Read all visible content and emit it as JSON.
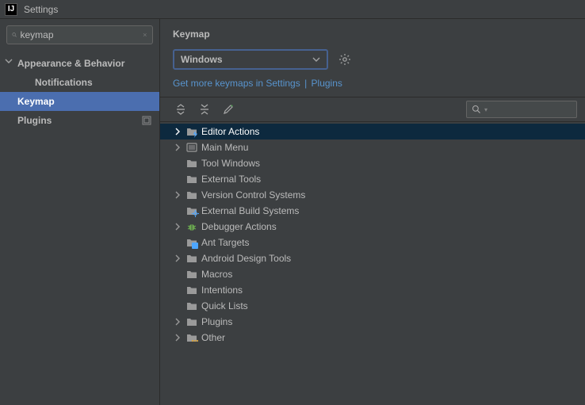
{
  "window": {
    "title": "Settings",
    "app_icon_text": "IJ"
  },
  "sidebar": {
    "search_value": "keymap",
    "items": [
      {
        "label": "Appearance & Behavior",
        "level": 1,
        "expandable": true,
        "expanded": true,
        "selected": false,
        "meta_icon": false
      },
      {
        "label": "Notifications",
        "level": 2,
        "expandable": false,
        "expanded": false,
        "selected": false,
        "meta_icon": false
      },
      {
        "label": "Keymap",
        "level": 1,
        "expandable": false,
        "expanded": false,
        "selected": true,
        "meta_icon": false
      },
      {
        "label": "Plugins",
        "level": 1,
        "expandable": false,
        "expanded": false,
        "selected": false,
        "meta_icon": true
      }
    ]
  },
  "content": {
    "title": "Keymap",
    "scheme": "Windows",
    "link_prefix": "Get more keymaps in ",
    "link_settings": "Settings",
    "link_sep": " | ",
    "link_plugins": "Plugins",
    "tree_search_placeholder": "",
    "tree": [
      {
        "label": "Editor Actions",
        "expandable": true,
        "selected": true,
        "icon": "folder-lightning"
      },
      {
        "label": "Main Menu",
        "expandable": true,
        "selected": false,
        "icon": "menu"
      },
      {
        "label": "Tool Windows",
        "expandable": false,
        "selected": false,
        "icon": "folder"
      },
      {
        "label": "External Tools",
        "expandable": false,
        "selected": false,
        "icon": "folder"
      },
      {
        "label": "Version Control Systems",
        "expandable": true,
        "selected": false,
        "icon": "folder"
      },
      {
        "label": "External Build Systems",
        "expandable": false,
        "selected": false,
        "icon": "folder-gear"
      },
      {
        "label": "Debugger Actions",
        "expandable": true,
        "selected": false,
        "icon": "bug"
      },
      {
        "label": "Ant Targets",
        "expandable": false,
        "selected": false,
        "icon": "folder-blue"
      },
      {
        "label": "Android Design Tools",
        "expandable": true,
        "selected": false,
        "icon": "folder"
      },
      {
        "label": "Macros",
        "expandable": false,
        "selected": false,
        "icon": "folder"
      },
      {
        "label": "Intentions",
        "expandable": false,
        "selected": false,
        "icon": "folder"
      },
      {
        "label": "Quick Lists",
        "expandable": false,
        "selected": false,
        "icon": "folder"
      },
      {
        "label": "Plugins",
        "expandable": true,
        "selected": false,
        "icon": "folder"
      },
      {
        "label": "Other",
        "expandable": true,
        "selected": false,
        "icon": "folder-dots"
      }
    ]
  }
}
